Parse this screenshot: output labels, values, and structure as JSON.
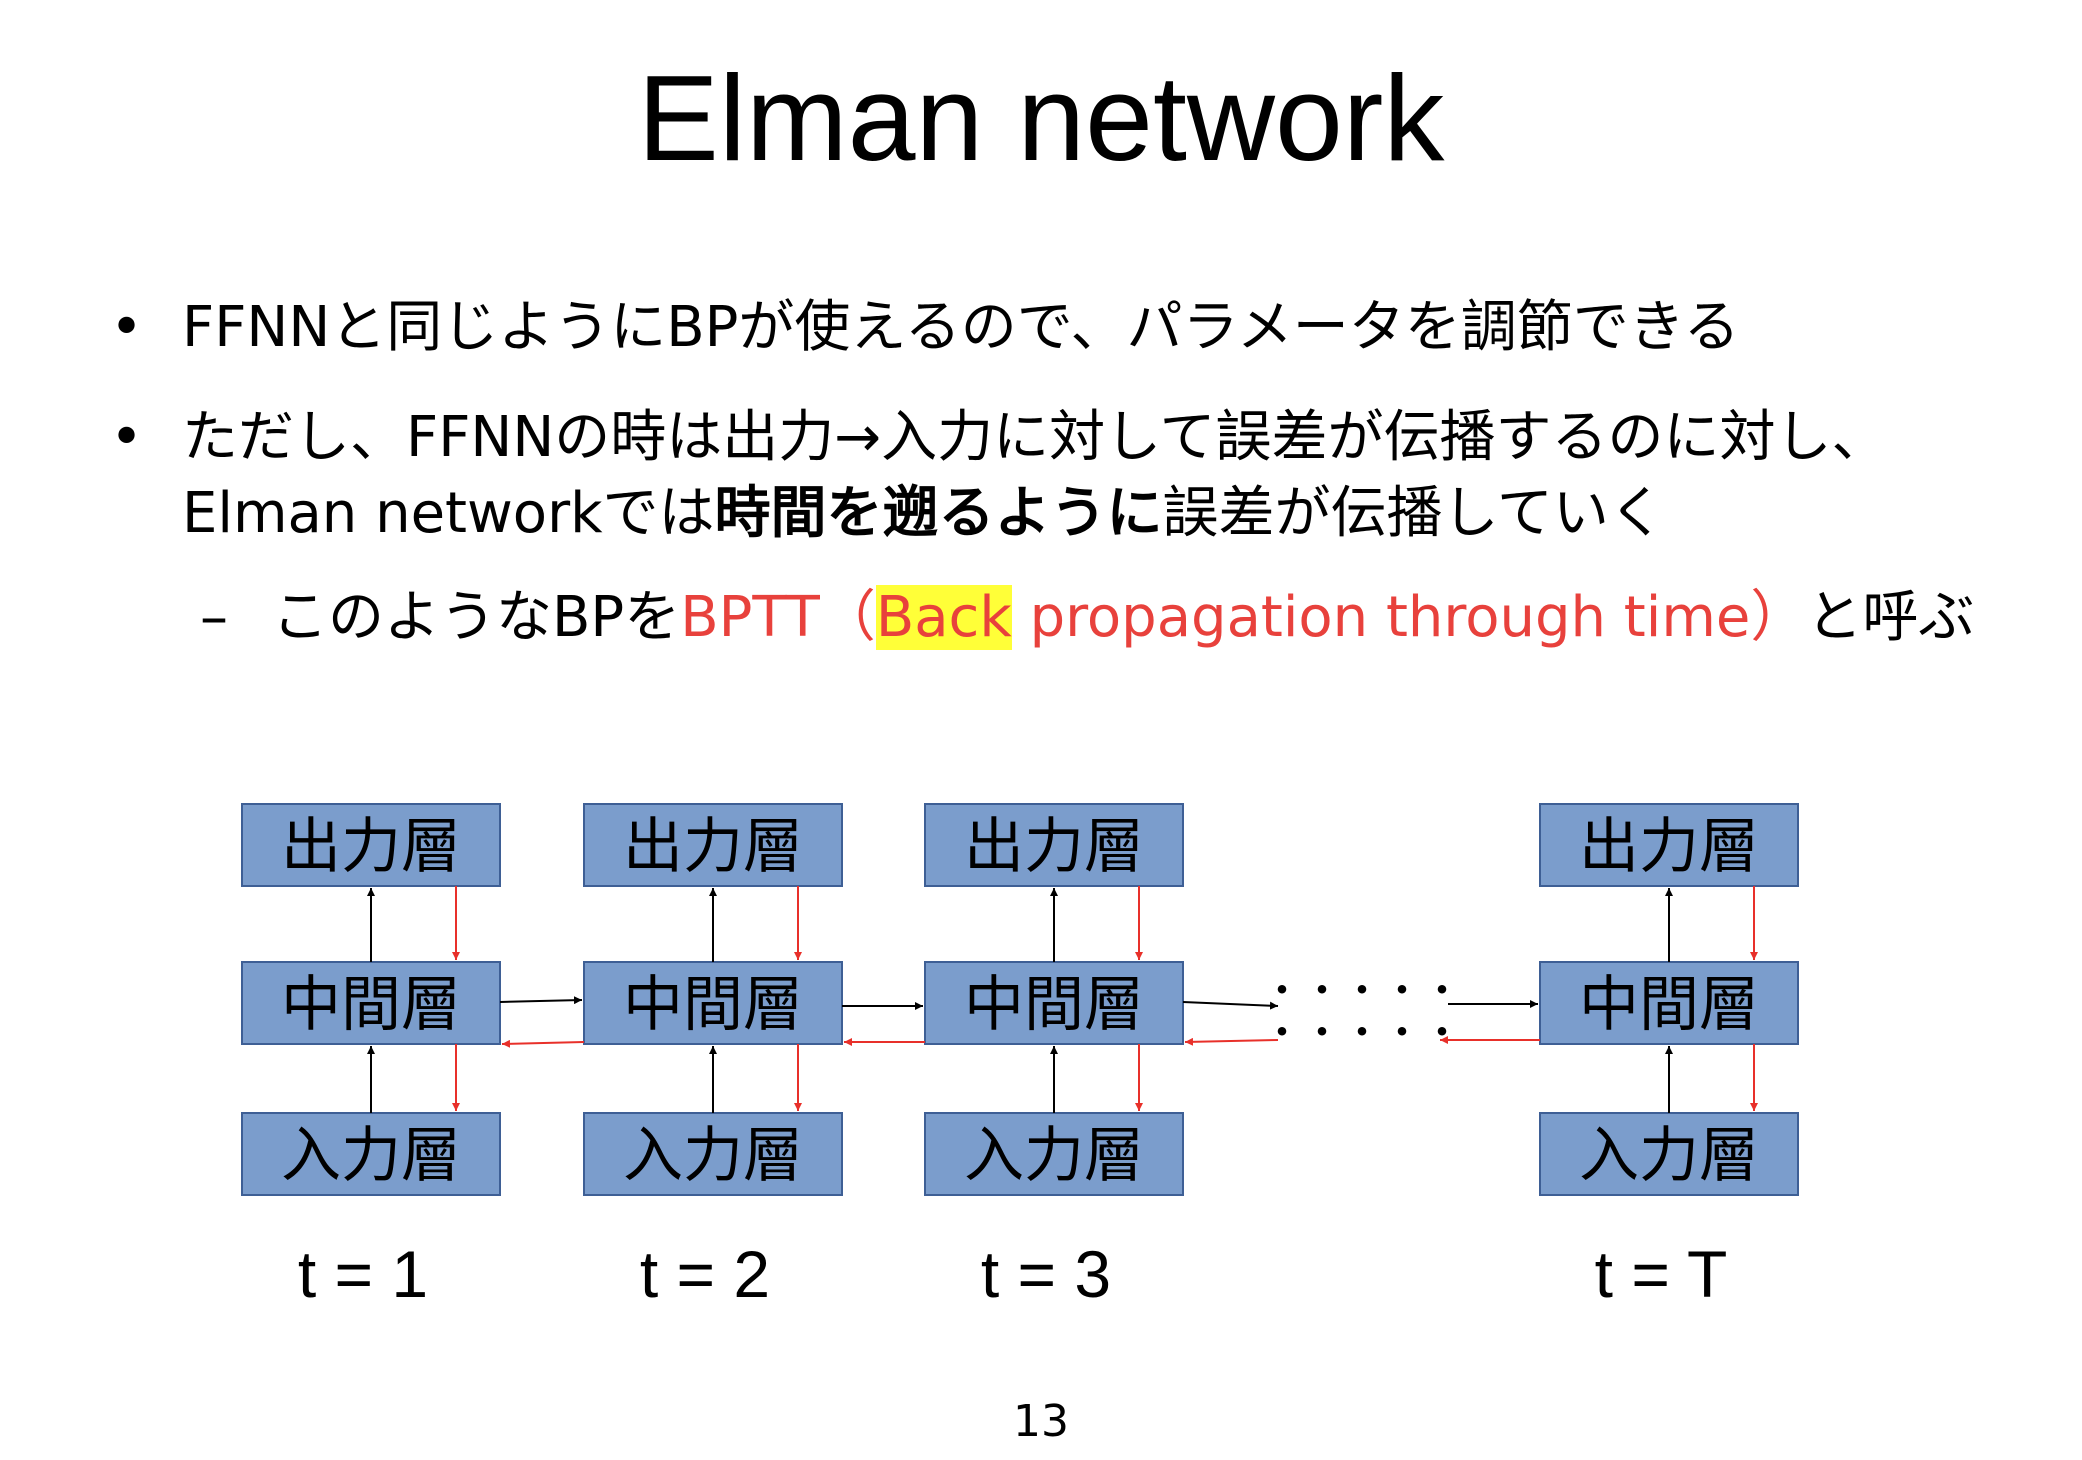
{
  "slide": {
    "title": "Elman network",
    "page_number": "13"
  },
  "bullets": {
    "b1": {
      "marker": "•",
      "text": "FFNNと同じようにBPが使えるので、パラメータを調節できる"
    },
    "b2": {
      "marker": "•",
      "line1": "ただし、FFNNの時は出力→入力に対して誤差が伝播するのに対し、",
      "line2_pre": "Elman networkでは",
      "line2_bold": "時間を遡るように",
      "line2_post": "誤差が伝播していく"
    },
    "b3": {
      "marker": "–",
      "pre": "このようなBPを",
      "red1": "BPTT（",
      "highlight": "Back",
      "red2": " propagation through time）",
      "post": "と呼ぶ"
    }
  },
  "diagram": {
    "output_label": "出力層",
    "hidden_label": "中間層",
    "input_label": "入力層",
    "columns": [
      {
        "time_label": "t = 1"
      },
      {
        "time_label": "t = 2"
      },
      {
        "time_label": "t = 3"
      },
      {
        "time_label": "t = T"
      }
    ],
    "ellipsis": "・・・・・",
    "colors": {
      "box_fill": "#7b9dcc",
      "box_stroke": "#3e5f95",
      "forward_arrow": "#000000",
      "backward_arrow": "#e8302a"
    }
  }
}
